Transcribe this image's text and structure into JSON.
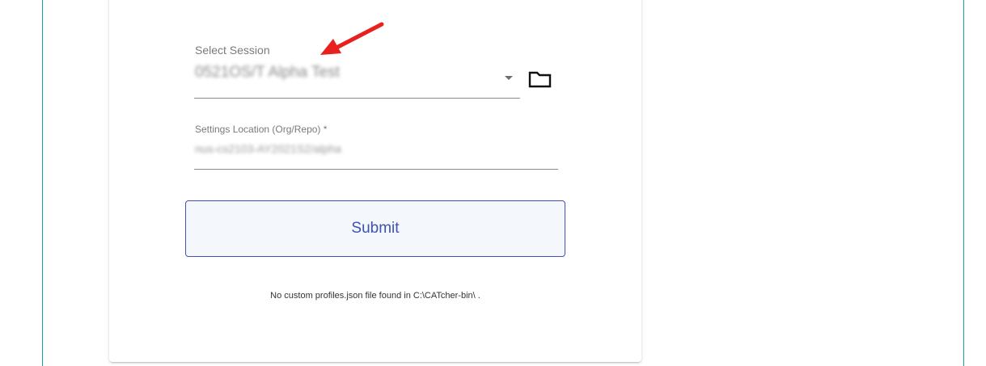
{
  "form": {
    "session_label": "Select Session",
    "session_value": "0521OS/T Alpha Test",
    "settings_label": "Settings Location (Org/Repo) *",
    "settings_value": "nus-cs2103-AY2021S2/alpha",
    "submit_label": "Submit",
    "footnote": "No custom profiles.json file found in C:\\CATcher-bin\\ ."
  },
  "icons": {
    "dropdown": "chevron-down-icon",
    "folder": "folder-icon",
    "annotation": "red-arrow-icon"
  },
  "colors": {
    "accent": "#3f51b5",
    "annotation_arrow": "#e8201e",
    "frame_border": "#1aa39a"
  }
}
